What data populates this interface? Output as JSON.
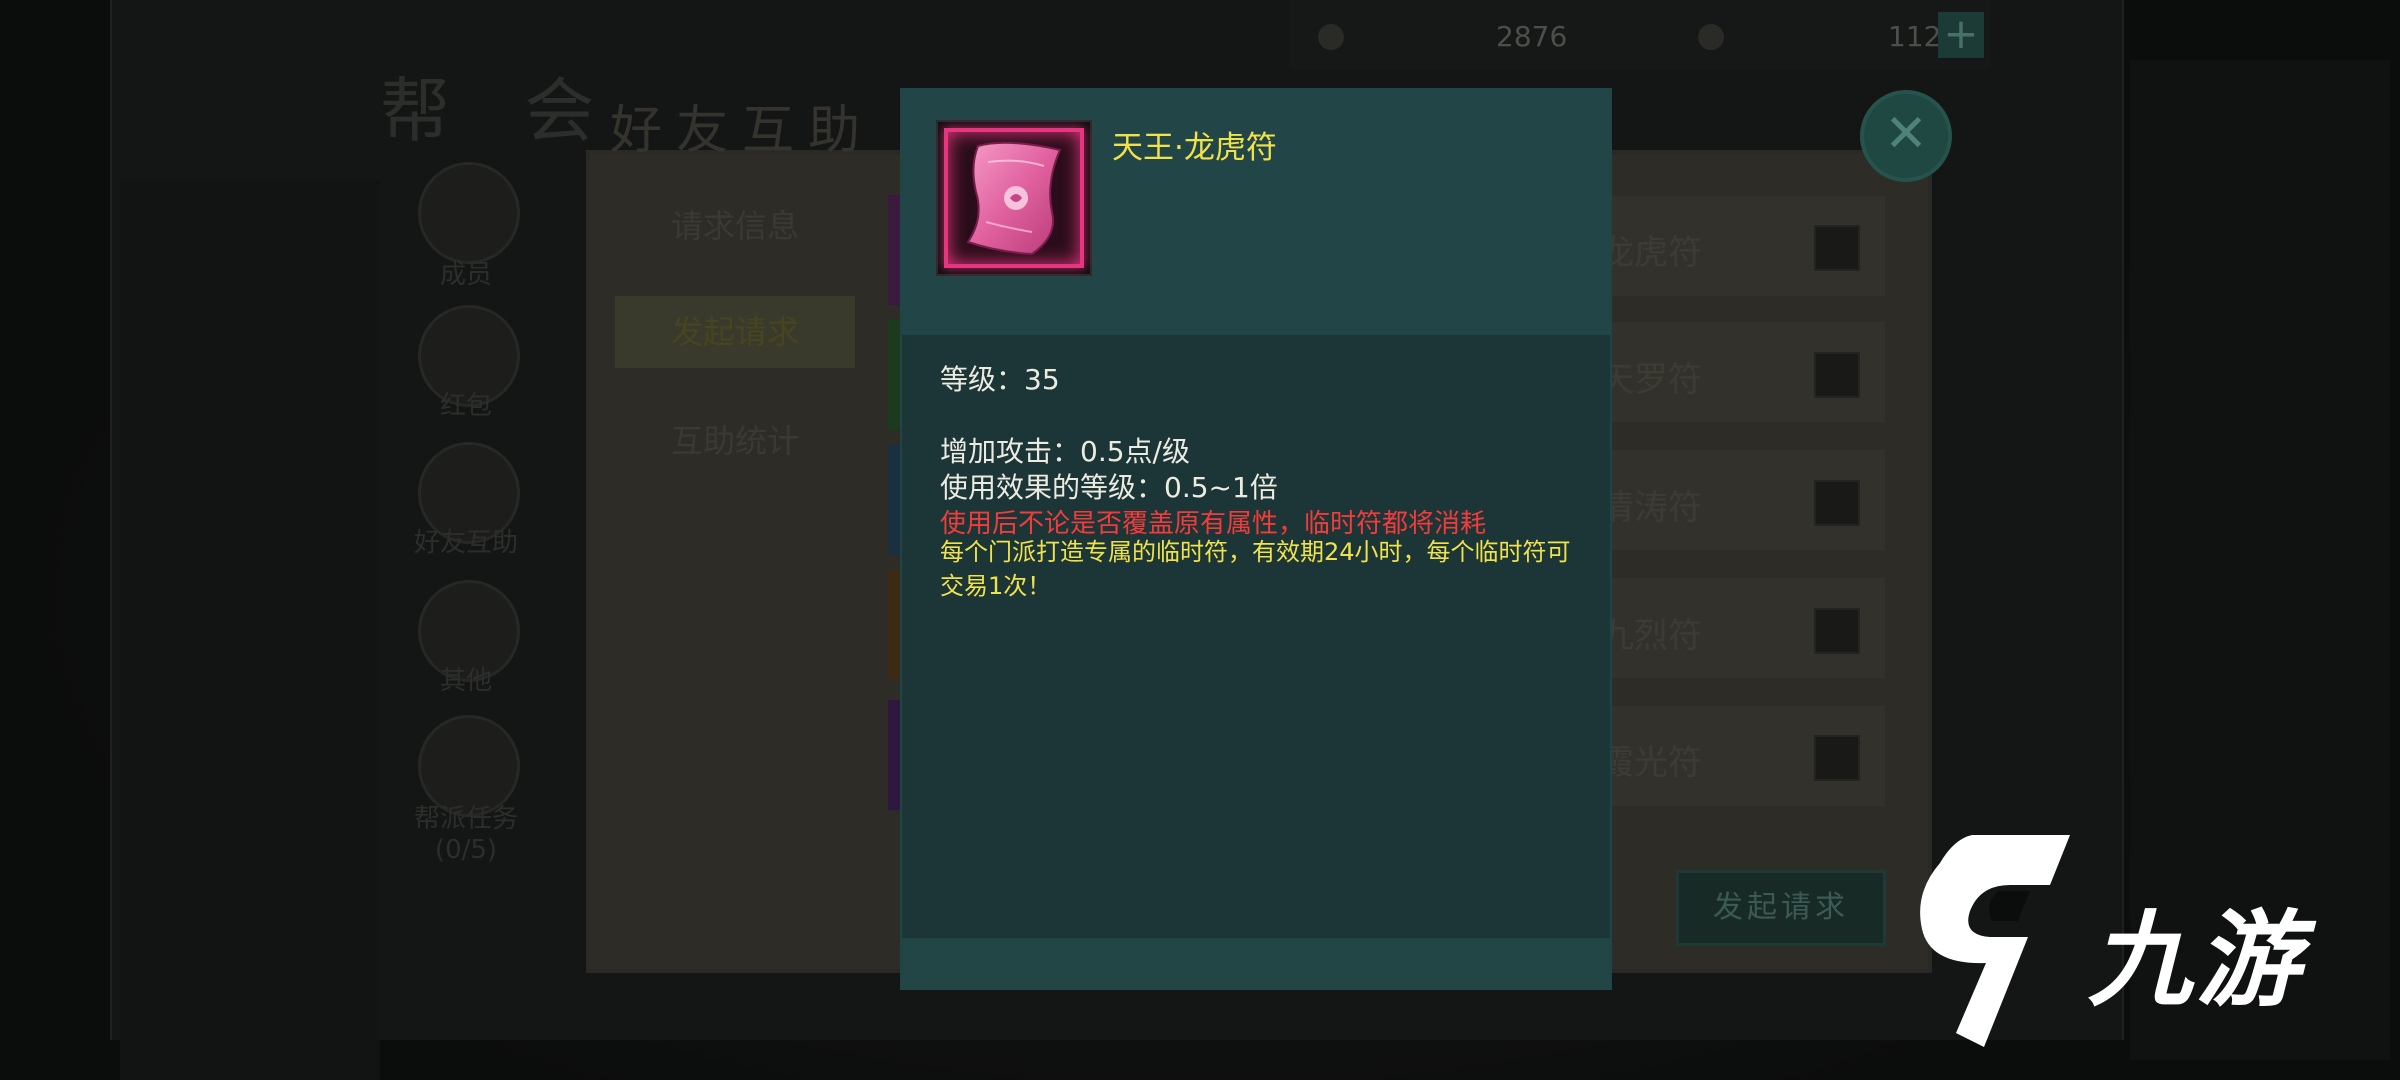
{
  "top_bar": {
    "currency_1": "2876",
    "currency_2": "112",
    "plus_label": "+"
  },
  "guild_title": "帮 会",
  "dialog_title": "好友互助",
  "side_menu": [
    {
      "label": "成员"
    },
    {
      "label": "红包"
    },
    {
      "label": "好友互助"
    },
    {
      "label": "其他"
    },
    {
      "label": "帮派任务"
    }
  ],
  "side_task_progress": "(0/5)",
  "tabs": [
    {
      "label": "请求信息",
      "active": false
    },
    {
      "label": "发起请求",
      "active": true
    },
    {
      "label": "互助统计",
      "active": false
    }
  ],
  "request_list": [
    {
      "label": "龙虎符"
    },
    {
      "label": "天罗符"
    },
    {
      "label": "清涛符"
    },
    {
      "label": "九烈符"
    },
    {
      "label": "霞光符"
    }
  ],
  "start_request_button": "发起请求",
  "close_icon": "close-icon",
  "tooltip": {
    "item_name": "天王·龙虎符",
    "level_line": "等级：35",
    "attack_line": "增加攻击：0.5点/级",
    "effect_line": "使用效果的等级：0.5~1倍",
    "warning_line": "使用后不论是否覆盖原有属性，临时符都将消耗",
    "description": "每个门派打造专属的临时符，有效期24小时，每个临时符可交易1次！",
    "colors": {
      "name": "#f2e24a",
      "warning": "#f23c3c",
      "description": "#efe24c",
      "item_border": "#e8357f"
    }
  },
  "watermark": {
    "text": "九游",
    "logo_icon": "jiuyou-logo-icon"
  }
}
